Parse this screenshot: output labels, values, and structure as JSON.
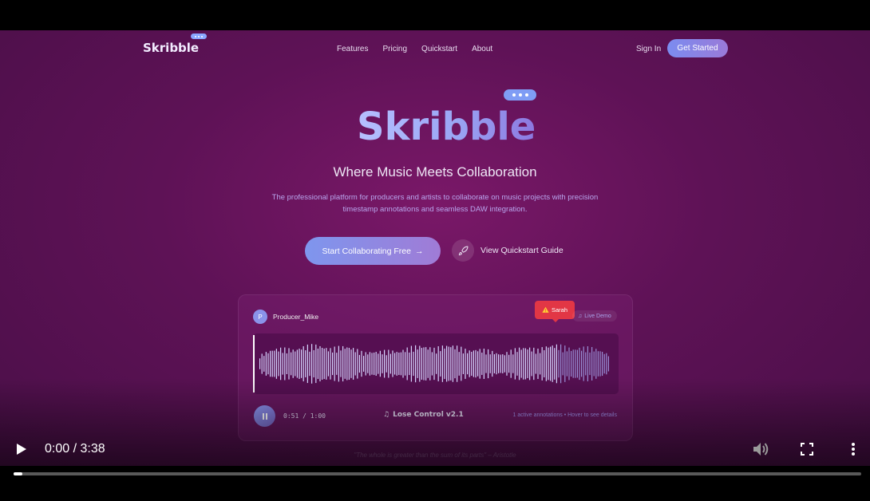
{
  "nav": {
    "logo": "Skribble",
    "links": [
      "Features",
      "Pricing",
      "Quickstart",
      "About"
    ],
    "sign_in": "Sign In",
    "get_started": "Get Started"
  },
  "hero": {
    "logo": "Skribble",
    "tagline": "Where Music Meets Collaboration",
    "description": "The professional platform for producers and artists to collaborate on music projects with precision timestamp annotations and seamless DAW integration.",
    "primary_button": "Start Collaborating Free",
    "primary_arrow": "→",
    "secondary_button": "View Quickstart Guide"
  },
  "demo": {
    "avatar_initial": "P",
    "user_name": "Producer_Mike",
    "annotation_user": "Sarah",
    "live_label": "Live Demo",
    "time": "0:51 / 1:00",
    "track_name": "Lose Control v2.1",
    "annotations_info": "1 active annotations • Hover to see details",
    "accent_color": "#e23645",
    "progress_fraction": 0.85
  },
  "quote": "\"The whole is greater than the sum of its parts\" – Aristotle",
  "player": {
    "time_display": "0:00 / 3:38",
    "progress_fraction": 0.01
  }
}
